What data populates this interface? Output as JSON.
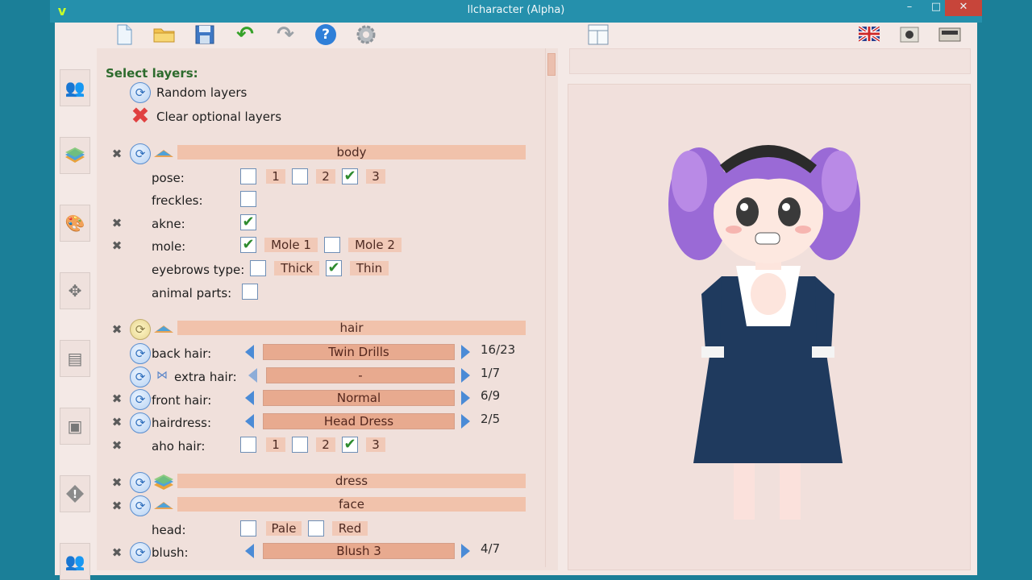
{
  "window": {
    "title": "llcharacter (Alpha)",
    "logo": "v"
  },
  "window_buttons": {
    "minimize": "–",
    "maximize": "□",
    "close": "✕"
  },
  "toolbar": {
    "icons": [
      "new-file-icon",
      "open-folder-icon",
      "save-icon",
      "undo-icon",
      "redo-icon",
      "help-icon",
      "settings-icon",
      "layout-icon",
      "language-uk-icon",
      "camera-icon",
      "export-icon"
    ],
    "help_glyph": "?",
    "undo_glyph": "↶",
    "redo_glyph": "↷"
  },
  "sidebar": [
    "characters-icon",
    "layers-icon",
    "palette-icon",
    "move-icon",
    "document-icon",
    "image-icon",
    "warning-icon",
    "people-icon"
  ],
  "panel": {
    "heading": "Select layers:",
    "random": "Random layers",
    "clear": "Clear optional layers",
    "clear_glyph": "✖",
    "x_glyph": "✖",
    "refresh_glyph": "⟳",
    "check_glyph": "✔",
    "body": {
      "title": "body",
      "pose_label": "pose:",
      "pose_options": [
        "1",
        "2",
        "3"
      ],
      "freckles_label": "freckles:",
      "akne_label": "akne:",
      "mole_label": "mole:",
      "mole_options": [
        "Mole 1",
        "Mole 2"
      ],
      "eyebrows_label": "eyebrows type:",
      "eyebrows_options": [
        "Thick",
        "Thin"
      ],
      "animal_label": "animal parts:"
    },
    "hair": {
      "title": "hair",
      "back_label": "back hair:",
      "back_value": "Twin Drills",
      "back_count": "16/23",
      "extra_label": "extra hair:",
      "extra_value": "-",
      "extra_count": "1/7",
      "front_label": "front hair:",
      "front_value": "Normal",
      "front_count": "6/9",
      "dress_label": "hairdress:",
      "dress_value": "Head Dress",
      "dress_count": "2/5",
      "aho_label": "aho hair:",
      "aho_options": [
        "1",
        "2",
        "3"
      ]
    },
    "dress_title": "dress",
    "face": {
      "title": "face",
      "head_label": "head:",
      "head_options": [
        "Pale",
        "Red"
      ],
      "blush_label": "blush:",
      "blush_value": "Blush 3",
      "blush_count": "4/7"
    }
  },
  "colors": {
    "accent": "#4b8bd6",
    "panel_bg": "#f0e0db",
    "bar": "#f1c2ab",
    "select": "#e8aa8f"
  }
}
